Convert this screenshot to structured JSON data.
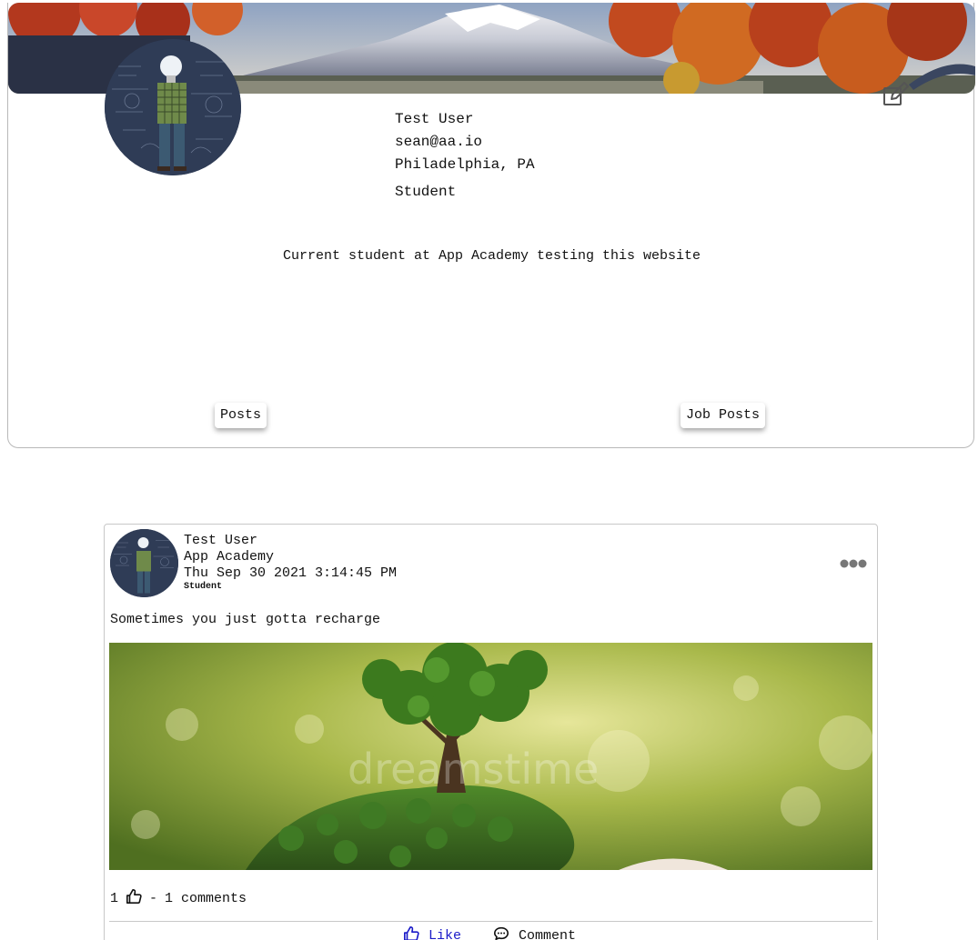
{
  "profile": {
    "name": "Test User",
    "email": "sean@aa.io",
    "location": "Philadelphia, PA",
    "role": "Student",
    "bio": "Current student at App Academy testing this website",
    "tabs": {
      "posts": "Posts",
      "job_posts": "Job Posts"
    }
  },
  "post": {
    "author": "Test User",
    "company": "App Academy",
    "timestamp": "Thu Sep 30 2021 3:14:45 PM",
    "tag": "Student",
    "text": "Sometimes you just gotta recharge",
    "image_watermark": "dreamstime",
    "likes_count": "1",
    "separator": "-",
    "comments_text": "1 comments",
    "like_label": "Like",
    "comment_label": "Comment"
  },
  "icons": {
    "edit": "edit-icon",
    "more": "more-horizontal-icon",
    "like": "thumbs-up-icon",
    "comment": "comment-icon"
  },
  "colors": {
    "like_action": "#1a1ac8",
    "border": "#c8c8c8"
  }
}
